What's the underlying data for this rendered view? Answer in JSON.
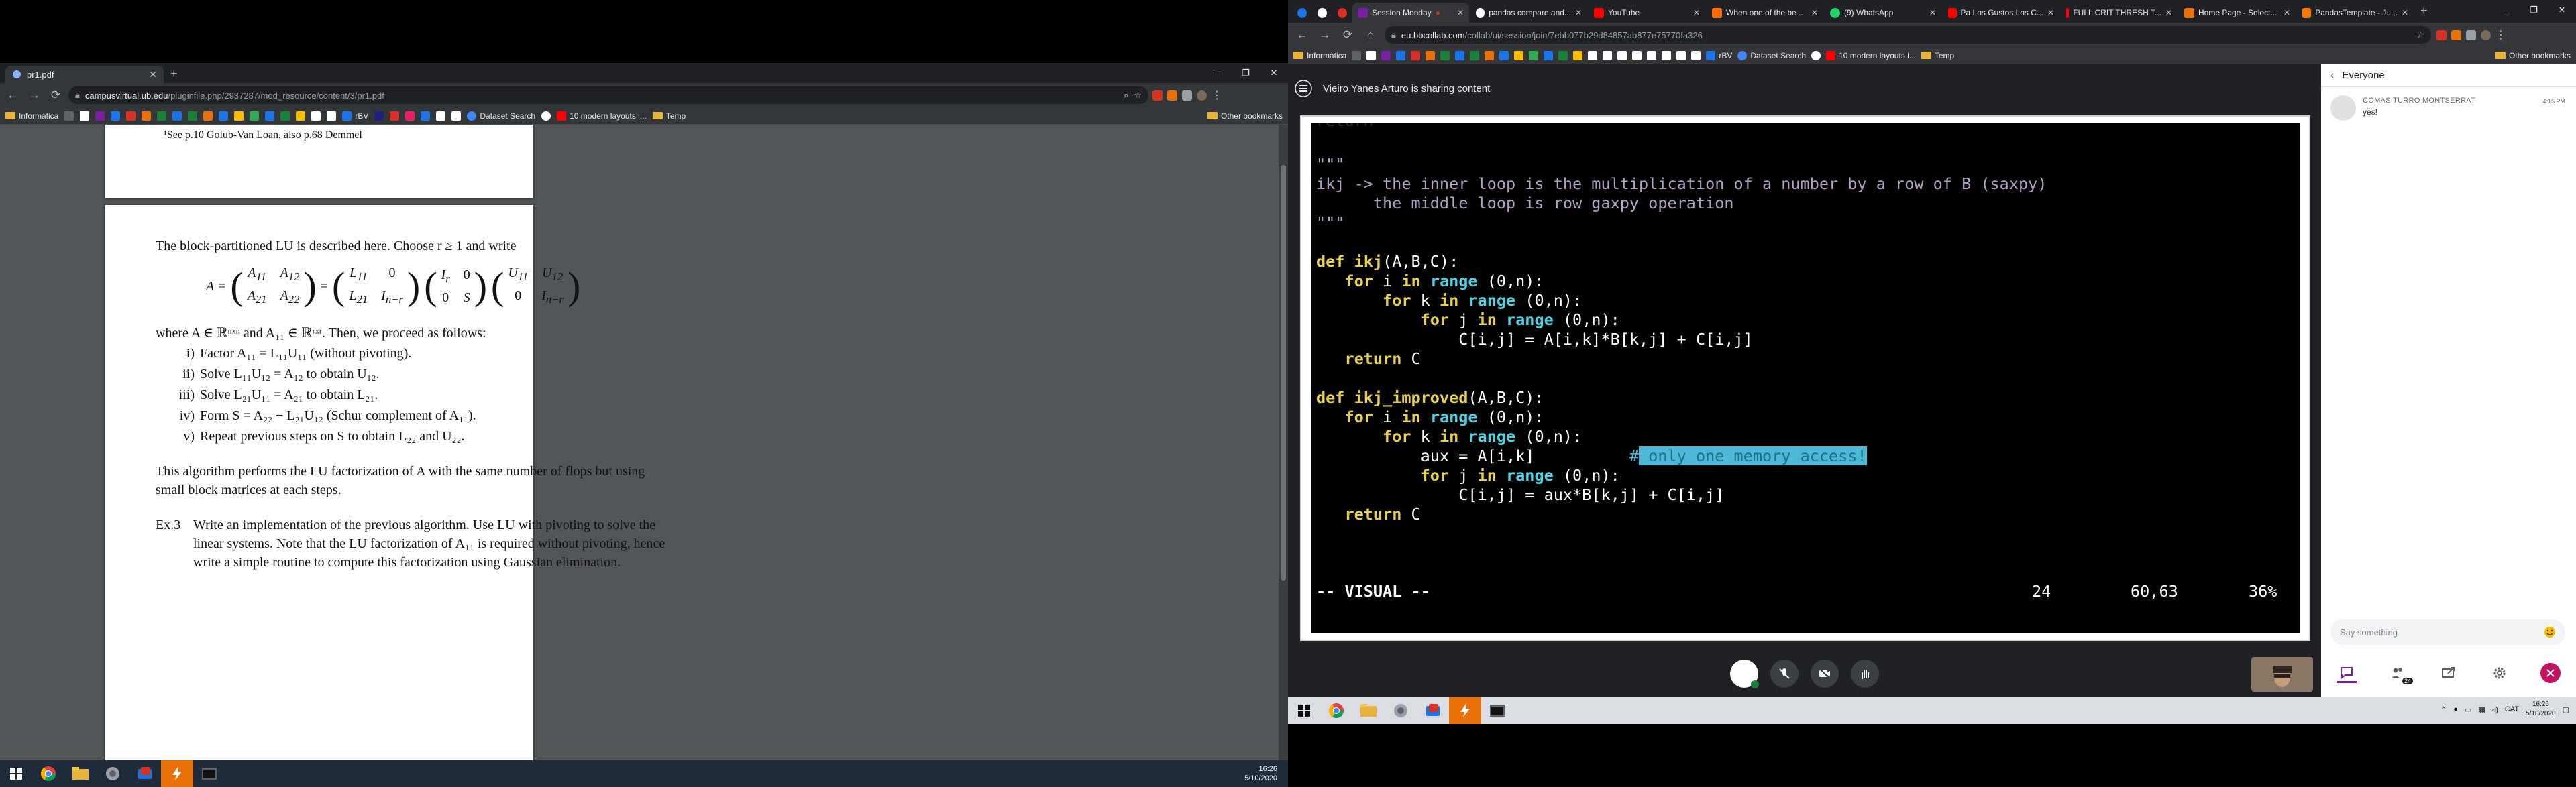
{
  "left": {
    "tab": {
      "title": "pr1.pdf"
    },
    "window_controls": [
      "–",
      "❐",
      "✕"
    ],
    "address": {
      "host": "campusvirtual.ub.edu",
      "path": "/pluginfile.php/2937287/mod_resource/content/3/pr1.pdf"
    },
    "bookmarks": [
      "Informàtica",
      "rBV",
      "Dataset Search",
      "10 modern layouts i...",
      "Temp",
      "Other bookmarks"
    ],
    "pdf": {
      "footnote": "¹See p.10 Golub-Van Loan, also p.68 Demmel",
      "intro": "The block-partitioned LU is described here.  Choose r ≥ 1 and write",
      "eq_lhs": "A =",
      "where": "where A ∈ ℝⁿˣⁿ and A₁₁ ∈ ℝʳˣʳ.  Then, we proceed as follows:",
      "steps": [
        {
          "num": "i)",
          "text": "Factor A₁₁ = L₁₁U₁₁ (without pivoting)."
        },
        {
          "num": "ii)",
          "text": "Solve L₁₁U₁₂ = A₁₂ to obtain U₁₂."
        },
        {
          "num": "iii)",
          "text": "Solve L₂₁U₁₁ = A₂₁ to obtain L₂₁."
        },
        {
          "num": "iv)",
          "text": "Form S = A₂₂ − L₂₁U₁₂ (Schur complement of A₁₁)."
        },
        {
          "num": "v)",
          "text": "Repeat previous steps on S to obtain L₂₂ and U₂₂."
        }
      ],
      "para1": "This algorithm performs the LU factorization of A with the same number of flops but using",
      "para2": "small block matrices at each steps.",
      "ex_label": "Ex.3",
      "ex_line1": "Write an implementation of the previous algorithm.  Use LU with pivoting to solve the",
      "ex_line2": "linear systems.  Note that the LU factorization of A₁₁ is required without pivoting, hence",
      "ex_line3": "write a simple routine to compute this factorization using Gaussian elimination."
    },
    "clock": {
      "time": "16:26",
      "date": "5/10/2020"
    }
  },
  "right": {
    "tabs": [
      "Session Monday",
      "pandas compare and...",
      "YouTube",
      "When one of the be...",
      "(9) WhatsApp",
      "Pa Los Gustos Los C...",
      "FULL CRIT THRESH T...",
      "Home Page - Select...",
      "PandasTemplate - Ju..."
    ],
    "address": {
      "host": "eu.bbcollab.com",
      "path": "/collab/ui/session/join/7ebb077b29d84857ab877e75770fa326"
    },
    "bookmarks": [
      "Informàtica",
      "rBV",
      "Dataset Search",
      "10 modern layouts i...",
      "Temp",
      "Other bookmarks"
    ],
    "sharing_text": "Vieiro Yanes Arturo is sharing content",
    "code": {
      "l1": "\"\"\"",
      "l2": "ikj -> the inner loop is the multiplication of a number by a row of B (saxpy)",
      "l3": "      the middle loop is row gaxpy operation",
      "l4": "\"\"\"",
      "def1_kw": "def ",
      "def1_name": "ikj",
      "def1_rest": "(A,B,C):",
      "for_i": "for",
      "in": "in",
      "range": "range",
      "i_var": " i ",
      "k_var": " k ",
      "j_var": " j ",
      "range_args": " (0,n):",
      "body1": "C[i,j] = A[i,k]*B[k,j] + C[i,j]",
      "return": "return",
      "ret_val": " C",
      "def2_name": "ikj_improved",
      "aux_line": "aux = A[i,k]",
      "comment_hash": "#",
      "comment_hl": " only one memory access!",
      "body2": "C[i,j] = aux*B[k,j] + C[i,j]",
      "mode": "-- VISUAL --",
      "sel_count": "24",
      "position": "60,63",
      "percent": "36%"
    },
    "panel": {
      "title": "Everyone",
      "msg_name": "COMAS TURRO MONTSERRAT",
      "msg_time": "4:15 PM",
      "msg_text": "yes!",
      "input_placeholder": "Say something",
      "badge": "24"
    },
    "tray": {
      "lang": "CAT",
      "time": "16:26",
      "date": "5/10/2020"
    }
  }
}
